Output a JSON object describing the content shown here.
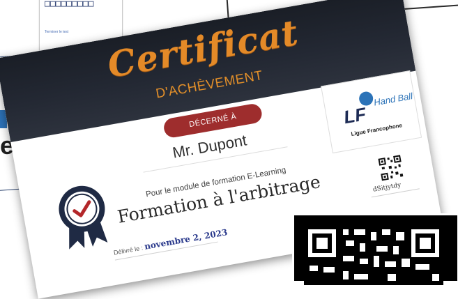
{
  "background": {
    "top_card": {
      "boxes": "□□□□□□□□□",
      "link": "Terminer le test"
    },
    "left_card": {
      "letter": "e"
    }
  },
  "certificate": {
    "title": "Certificat",
    "subtitle": "D'ACHÈVEMENT",
    "awarded_label": "DÉCERNÉ À",
    "recipient": "Mr. Dupont",
    "module_text": "Pour le module de formation E-Learning",
    "course_name": "Formation à l'arbitrage",
    "date_label": "Délivré le :",
    "date_value": "novembre 2, 2023",
    "verification_code": "dSitjytdy",
    "logo": {
      "initials": "LF",
      "word": "Hand Ball",
      "league": "Ligue Francophone"
    }
  },
  "colors": {
    "header_dark": "#1f232b",
    "title_orange": "#e48a28",
    "ribbon_red": "#9e2d2d",
    "date_blue": "#2b3a8c",
    "badge_navy": "#1f2a44",
    "badge_check": "#b3272a",
    "logo_blue": "#2c73b8"
  },
  "icons": {
    "badge": "award-badge-icon",
    "qr": "qr-code-icon"
  }
}
